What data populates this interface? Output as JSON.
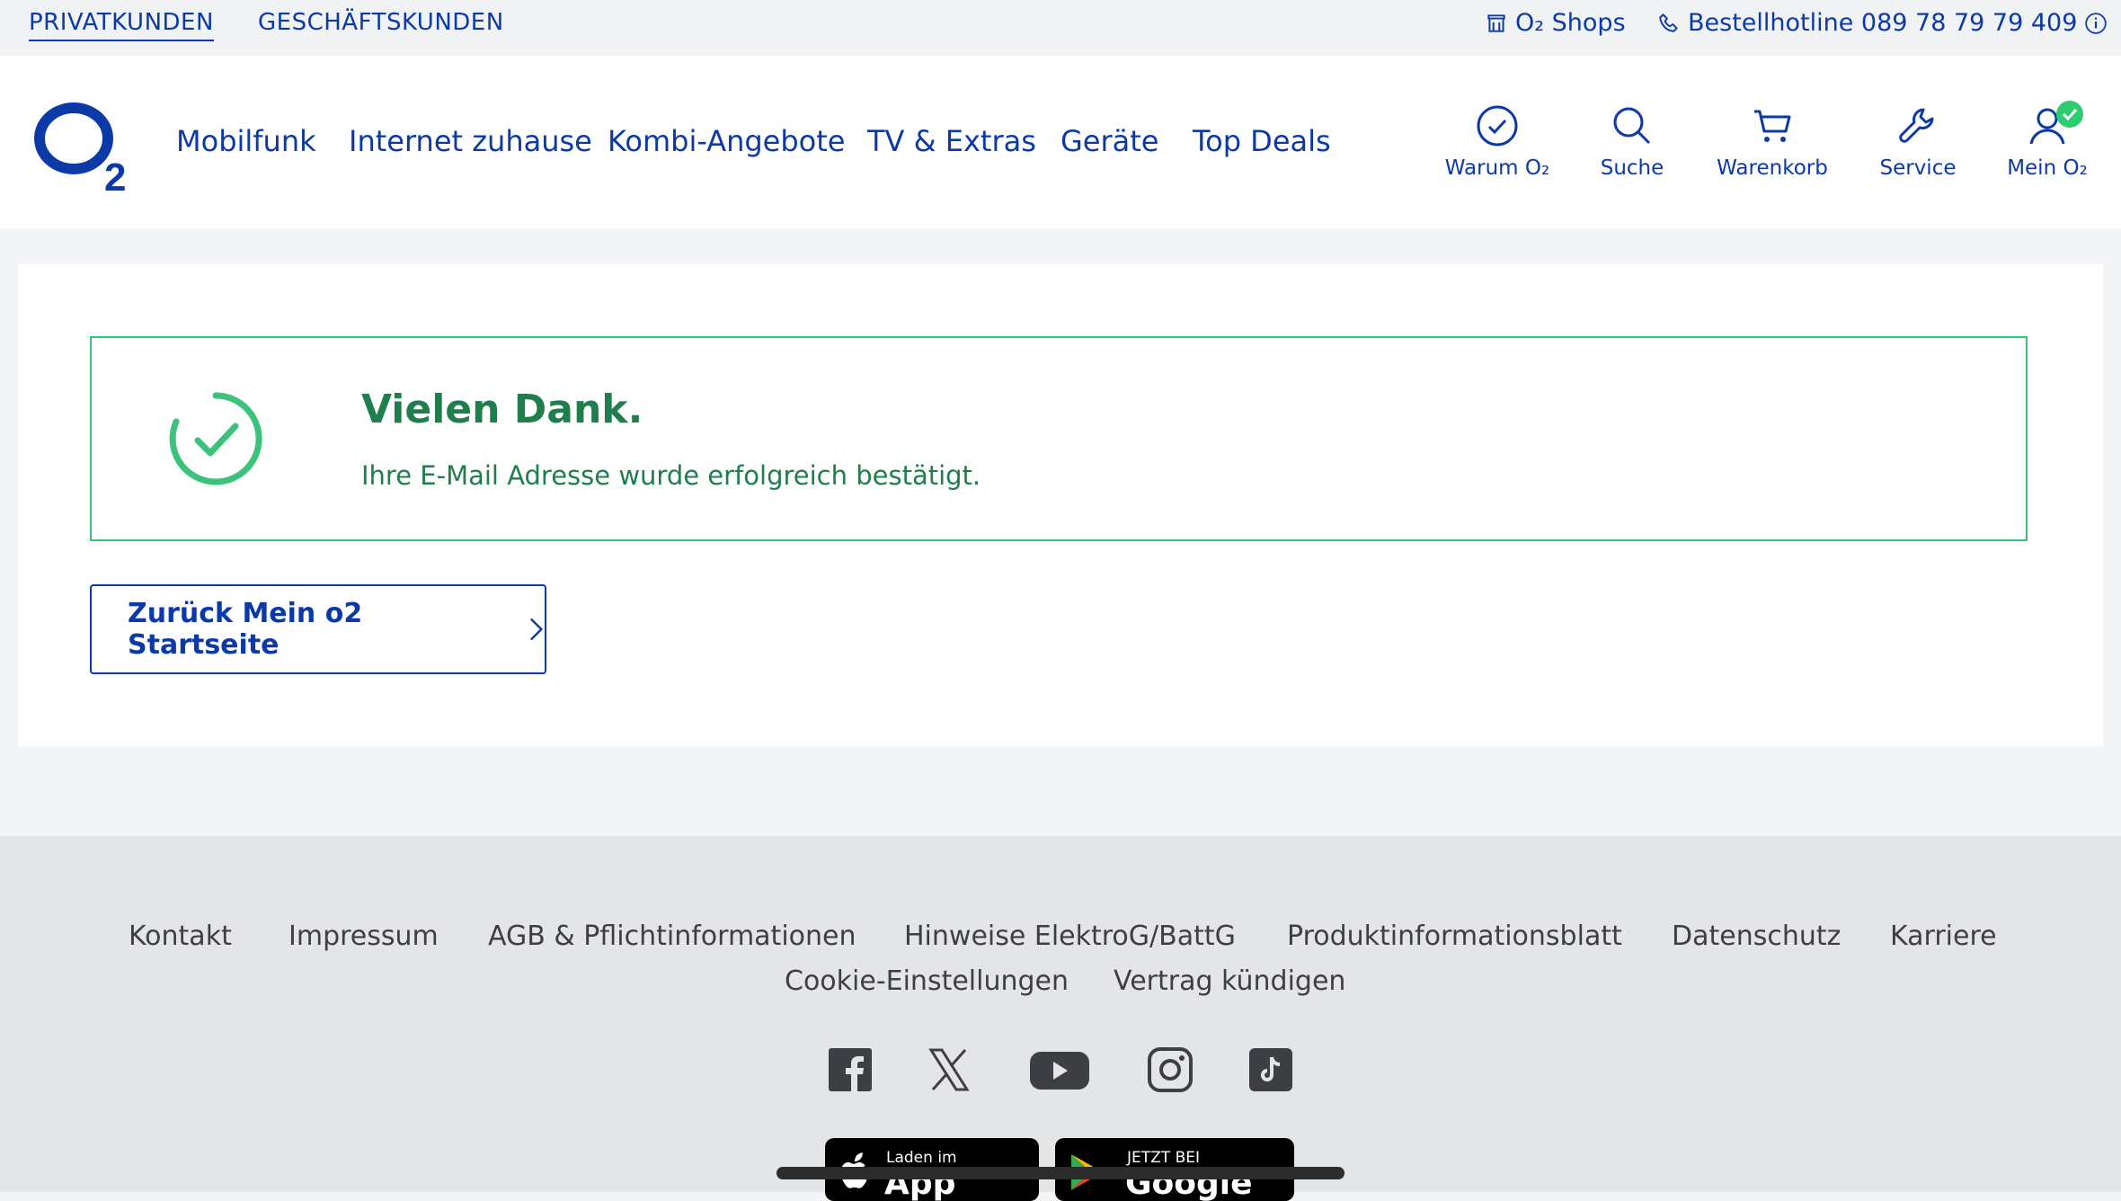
{
  "topbar": {
    "segments": [
      "PRIVATKUNDEN",
      "GESCHÄFTSKUNDEN"
    ],
    "shops_label": "O₂ Shops",
    "hotline_label": "Bestellhotline 089 78 79 79 409"
  },
  "header": {
    "logo_alt": "O₂",
    "nav": [
      "Mobilfunk",
      "Internet zuhause",
      "Kombi-Angebote",
      "TV & Extras",
      "Geräte",
      "Top Deals"
    ],
    "actions": {
      "why": "Warum O₂",
      "search": "Suche",
      "cart": "Warenkorb",
      "service": "Service",
      "account": "Mein O₂"
    }
  },
  "content": {
    "success_title": "Vielen Dank.",
    "success_text": "Ihre E-Mail Adresse wurde erfolgreich bestätigt.",
    "back_button": "Zurück Mein o2 Startseite"
  },
  "footer": {
    "links_row1": [
      "Kontakt",
      "Impressum",
      "AGB & Pflichtinformationen",
      "Hinweise ElektroG/BattG",
      "Produktinformationsblatt",
      "Datenschutz",
      "Karriere"
    ],
    "links_row2": [
      "Cookie-Einstellungen",
      "Vertrag kündigen"
    ],
    "social_icons": [
      "facebook-icon",
      "x-icon",
      "youtube-icon",
      "instagram-icon",
      "tiktok-icon"
    ],
    "stores": {
      "apple_small": "Laden im",
      "apple_big": "App Store",
      "google_small": "JETZT BEI",
      "google_big": "Google Play"
    }
  },
  "colors": {
    "brand_blue": "#0b3aa8",
    "success_green": "#1e7f4c",
    "success_border": "#3cc27a"
  }
}
